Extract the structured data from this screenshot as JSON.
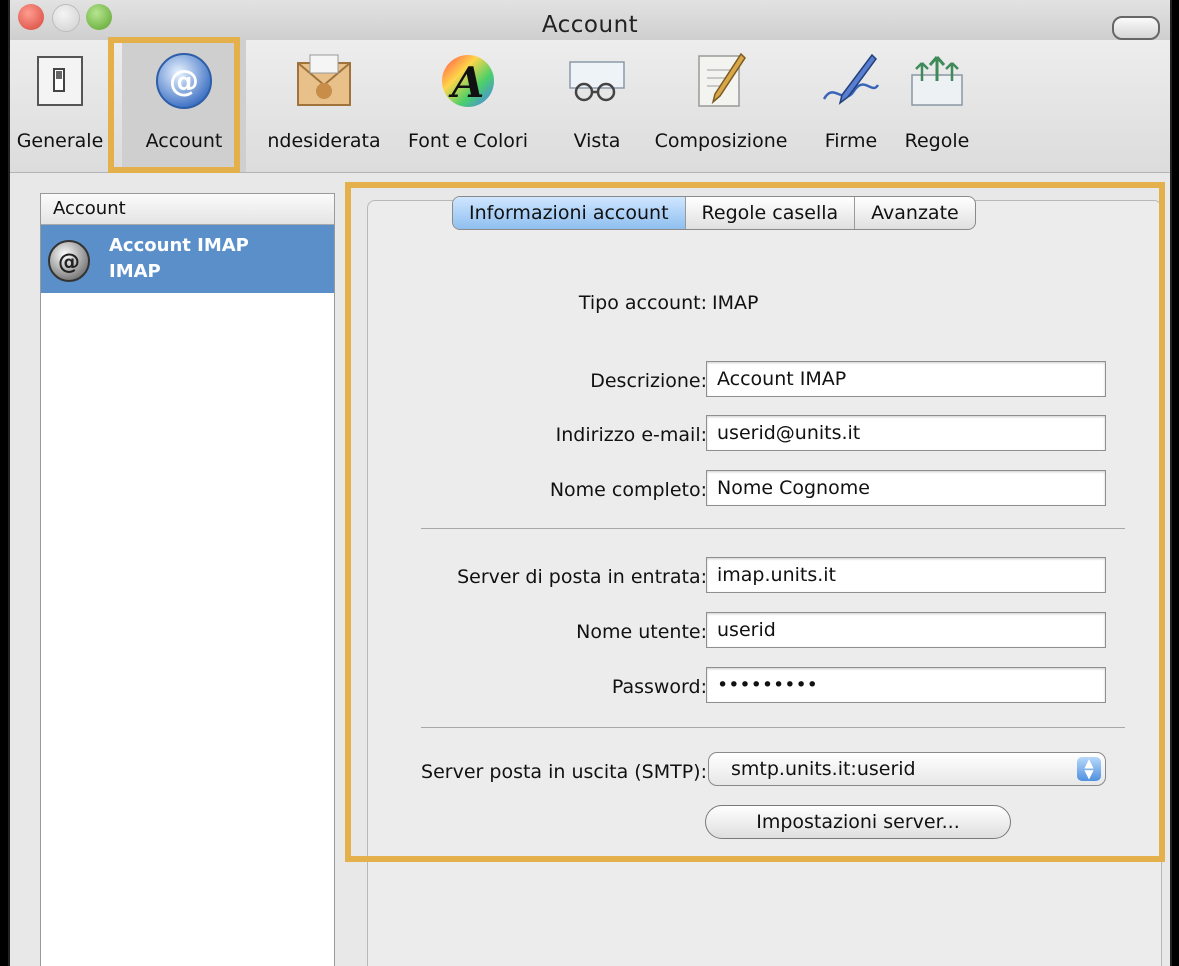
{
  "window": {
    "title": "Account"
  },
  "toolbar": {
    "items": [
      {
        "label": "Generale",
        "icon": "switch-icon"
      },
      {
        "label": "Account",
        "icon": "at-sign-icon",
        "selected": true
      },
      {
        "label": "ndesiderata",
        "icon": "junk-mail-icon"
      },
      {
        "label": "Font e Colori",
        "icon": "font-colors-icon"
      },
      {
        "label": "Vista",
        "icon": "glasses-icon"
      },
      {
        "label": "Composizione",
        "icon": "compose-pen-icon"
      },
      {
        "label": "Firme",
        "icon": "signature-pen-icon"
      },
      {
        "label": "Regole",
        "icon": "rules-arrows-icon"
      }
    ]
  },
  "sidebar": {
    "header": "Account",
    "accounts": [
      {
        "name": "Account IMAP",
        "type": "IMAP",
        "icon": "imap-at-icon"
      }
    ]
  },
  "tabs": [
    "Informazioni account",
    "Regole casella",
    "Avanzate"
  ],
  "form": {
    "account_type_label": "Tipo account:",
    "account_type_value": "IMAP",
    "description_label": "Descrizione:",
    "description_value": "Account IMAP",
    "email_label": "Indirizzo e-mail:",
    "email_value": "userid@units.it",
    "fullname_label": "Nome completo:",
    "fullname_value": "Nome Cognome",
    "incoming_label": "Server di posta in entrata:",
    "incoming_value": "imap.units.it",
    "username_label": "Nome utente:",
    "username_value": "userid",
    "password_label": "Password:",
    "password_value": "•••••••••",
    "smtp_label": "Server posta in uscita (SMTP):",
    "smtp_value": "smtp.units.it:userid",
    "server_settings_button": "Impostazioni server..."
  },
  "colors": {
    "highlight": "#e3b04b",
    "selection": "#5b8fc9"
  }
}
